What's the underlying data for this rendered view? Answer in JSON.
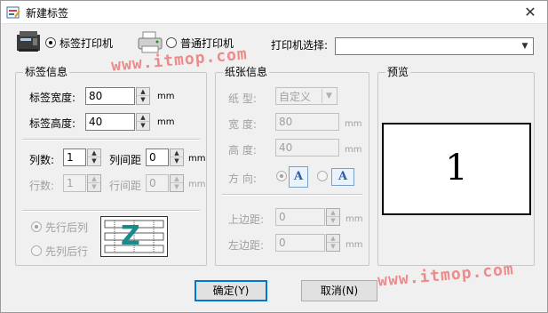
{
  "window": {
    "title": "新建标签",
    "close_glyph": "✕"
  },
  "printer_type": {
    "label_printer": "标签打印机",
    "normal_printer": "普通打印机",
    "select_label": "打印机选择:",
    "select_value": ""
  },
  "label_info": {
    "group_title": "标签信息",
    "width_label": "标签宽度:",
    "width_value": "80",
    "height_label": "标签高度:",
    "height_value": "40",
    "unit": "mm",
    "cols_label": "列数:",
    "cols_value": "1",
    "col_gap_label": "列间距",
    "col_gap_value": "0",
    "rows_label": "行数:",
    "rows_value": "1",
    "row_gap_label": "行间距",
    "row_gap_value": "0",
    "order_row_first": "先行后列",
    "order_col_first": "先列后行",
    "order_icon_letter": "Z"
  },
  "paper_info": {
    "group_title": "纸张信息",
    "type_label": "纸  型:",
    "type_value": "自定义",
    "width_label": "宽  度:",
    "width_value": "80",
    "height_label": "高  度:",
    "height_value": "40",
    "orientation_label": "方  向:",
    "orient_icon_letter": "A",
    "top_margin_label": "上边距:",
    "top_margin_value": "0",
    "left_margin_label": "左边距:",
    "left_margin_value": "0",
    "unit": "mm"
  },
  "preview": {
    "group_title": "预览",
    "number": "1"
  },
  "buttons": {
    "ok": "确定(Y)",
    "cancel": "取消(N)"
  },
  "watermark": "www.itmop.com",
  "icons": {
    "app": "label-app-icon",
    "label_printer": "label-printer-icon",
    "normal_printer": "normal-printer-icon",
    "close": "close-icon",
    "spin_up": "▲",
    "spin_down": "▼",
    "combo_arrow": "▼"
  }
}
